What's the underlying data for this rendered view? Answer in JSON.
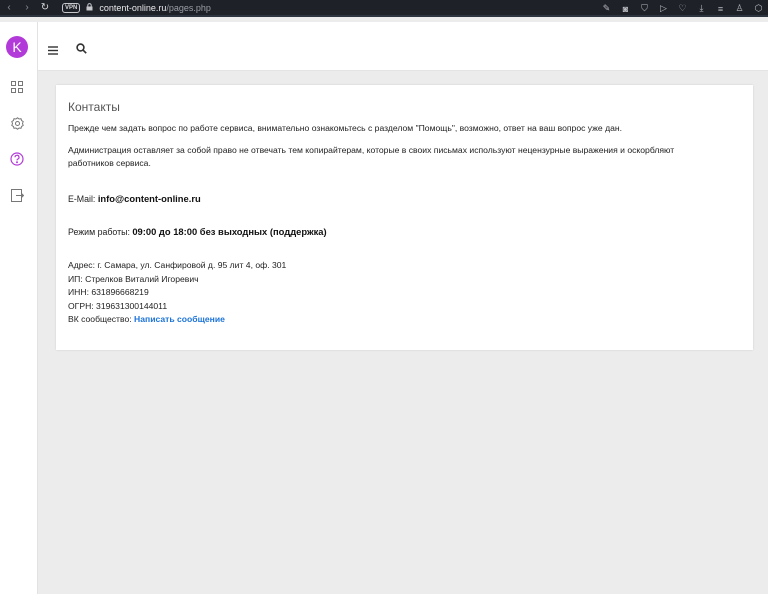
{
  "browser": {
    "url_domain": "content-online.ru",
    "url_path": "/pages.php",
    "vpn_label": "VPN",
    "icons": [
      "edit-icon",
      "camera-icon",
      "shield-icon",
      "send-icon",
      "heart-icon",
      "download-icon",
      "menu-icon",
      "user-icon",
      "extension-icon"
    ]
  },
  "sidebar": {
    "logo_letter": "K",
    "brand_color": "#b23ad8"
  },
  "page": {
    "title": "Контакты",
    "intro": "Прежде чем задать вопрос по работе сервиса, внимательно ознакомьтесь с разделом \"Помощь\", возможно, ответ на ваш вопрос уже дан.",
    "notice": "Администрация оставляет за собой право не отвечать тем копирайтерам, которые в своих письмах используют нецензурные выражения и оскорбляют работников сервиса.",
    "email_label": "E-Mail:",
    "email_value": "info@content-online.ru",
    "hours_label": "Режим работы:",
    "hours_value": "09:00 до 18:00 без выходных (поддержка)",
    "address": "Адрес: г. Самара, ул. Санфировой д. 95 лит 4, оф. 301",
    "ip": "ИП: Стрелков Виталий Игоревич",
    "inn": "ИНН: 631896668219",
    "ogrn": "ОГРН: 319631300144011",
    "vk_label": "ВК сообщество:",
    "vk_link": "Написать сообщение",
    "link_color": "#1b73d8"
  }
}
